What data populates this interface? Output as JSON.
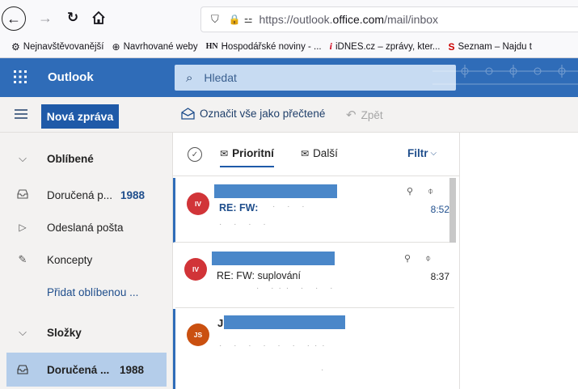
{
  "browser": {
    "url_prefix": "https://outlook.",
    "url_host": "office.com",
    "url_path": "/mail/inbox",
    "bookmarks": [
      {
        "icon": "⚙",
        "label": "Nejnavštěvovanější"
      },
      {
        "icon": "⊕",
        "label": "Navrhované weby"
      },
      {
        "icon": "HN",
        "label": "Hospodářské noviny - ..."
      },
      {
        "icon": "i",
        "label": "iDNES.cz – zprávy, kter..."
      },
      {
        "icon": "S",
        "label": "Seznam – Najdu t"
      }
    ]
  },
  "app": {
    "title": "Outlook",
    "search_placeholder": "Hledat",
    "new_message": "Nová zpráva",
    "mark_all_read": "Označit vše jako přečtené",
    "undo": "Zpět"
  },
  "folders": {
    "favorites": "Oblíbené",
    "inbox": "Doručená p...",
    "inbox_count": "1988",
    "sent": "Odeslaná pošta",
    "drafts": "Koncepty",
    "add_favorite": "Přidat oblíbenou ...",
    "folders_header": "Složky",
    "inbox2": "Doručená ...",
    "inbox2_count": "1988"
  },
  "list": {
    "tab_focused": "Prioritní",
    "tab_other": "Další",
    "filter": "Filtr",
    "messages": [
      {
        "initials": "IV",
        "subject": "RE: FW:",
        "time": "8:52",
        "color": "#d13438"
      },
      {
        "initials": "IV",
        "subject": "RE: FW: suplování",
        "time": "8:37",
        "color": "#d13438"
      },
      {
        "initials": "JS",
        "sender_initial": "J",
        "color": "#ca5010"
      }
    ]
  },
  "colors": {
    "header": "#2f6cb8",
    "accent": "#1f5aa8"
  }
}
